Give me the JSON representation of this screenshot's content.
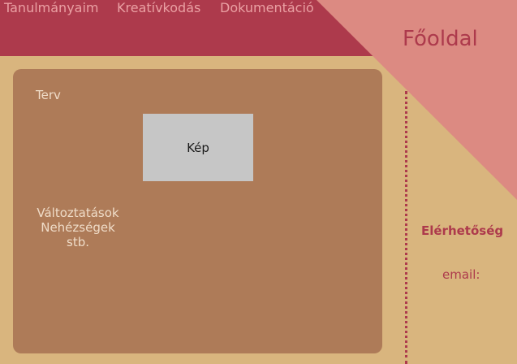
{
  "nav": {
    "items": [
      {
        "label": "Tanulmányaim"
      },
      {
        "label": "Kreatívkodás"
      },
      {
        "label": "Dokumentáció"
      }
    ],
    "home_label": "Főoldal"
  },
  "main": {
    "plan_label": "Terv",
    "image_placeholder": "Kép",
    "notes": [
      "Változtatások",
      "Nehézségek",
      "stb."
    ]
  },
  "sidebar": {
    "contact_title": "Elérhetőség",
    "email_label": "email:"
  },
  "colors": {
    "page_background": "#d9b57e",
    "top_bar": "#ad3a4c",
    "corner_triangle": "#dc8a82",
    "nav_text": "#eaa0a3",
    "content_panel": "#ae7b58",
    "image_placeholder": "#c6c6c6",
    "panel_text": "#efdcc8",
    "accent": "#ad3a4c"
  }
}
